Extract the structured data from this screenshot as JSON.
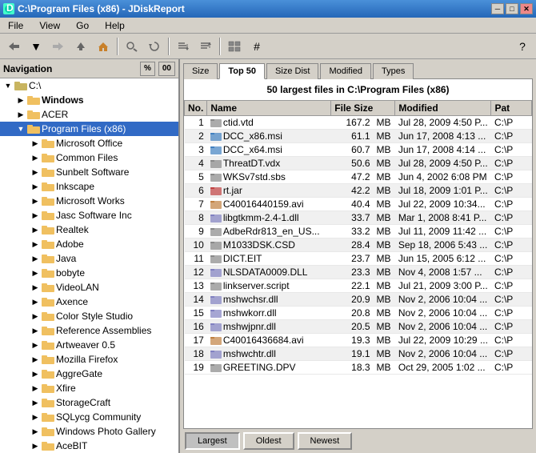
{
  "titleBar": {
    "title": "C:\\Program Files (x86) - JDiskReport",
    "icon": "disk-icon",
    "minimize": "─",
    "maximize": "□",
    "close": "✕"
  },
  "menu": {
    "items": [
      "File",
      "View",
      "Go",
      "Help"
    ]
  },
  "toolbar": {
    "buttons": [
      "◄",
      "▼",
      "◄",
      "►",
      "⌂",
      "🔍",
      "↺",
      "⇅",
      "⇵",
      "▦",
      "#"
    ],
    "help": "?"
  },
  "navigation": {
    "header": "Navigation",
    "percent": "%",
    "size": "00",
    "root": "C:\\",
    "tree": [
      {
        "label": "Windows",
        "level": 1,
        "expanded": true,
        "selected": false
      },
      {
        "label": "ACER",
        "level": 1,
        "expanded": false,
        "selected": false
      },
      {
        "label": "Program Files (x86)",
        "level": 1,
        "expanded": true,
        "selected": true
      },
      {
        "label": "Microsoft Office",
        "level": 2,
        "expanded": false,
        "selected": false
      },
      {
        "label": "Common Files",
        "level": 2,
        "expanded": false,
        "selected": false
      },
      {
        "label": "Sunbelt Software",
        "level": 2,
        "expanded": false,
        "selected": false
      },
      {
        "label": "Inkscape",
        "level": 2,
        "expanded": false,
        "selected": false
      },
      {
        "label": "Microsoft Works",
        "level": 2,
        "expanded": false,
        "selected": false
      },
      {
        "label": "Jasc Software Inc",
        "level": 2,
        "expanded": false,
        "selected": false
      },
      {
        "label": "Realtek",
        "level": 2,
        "expanded": false,
        "selected": false
      },
      {
        "label": "Adobe",
        "level": 2,
        "expanded": false,
        "selected": false
      },
      {
        "label": "Java",
        "level": 2,
        "expanded": false,
        "selected": false
      },
      {
        "label": "bobyte",
        "level": 2,
        "expanded": false,
        "selected": false
      },
      {
        "label": "VideoLAN",
        "level": 2,
        "expanded": false,
        "selected": false
      },
      {
        "label": "Axence",
        "level": 2,
        "expanded": false,
        "selected": false
      },
      {
        "label": "Color Style Studio",
        "level": 2,
        "expanded": false,
        "selected": false
      },
      {
        "label": "Reference Assemblies",
        "level": 2,
        "expanded": false,
        "selected": false
      },
      {
        "label": "Artweaver 0.5",
        "level": 2,
        "expanded": false,
        "selected": false
      },
      {
        "label": "Mozilla Firefox",
        "level": 2,
        "expanded": false,
        "selected": false
      },
      {
        "label": "AggreGate",
        "level": 2,
        "expanded": false,
        "selected": false
      },
      {
        "label": "Xfire",
        "level": 2,
        "expanded": false,
        "selected": false
      },
      {
        "label": "StorageCraft",
        "level": 2,
        "expanded": false,
        "selected": false
      },
      {
        "label": "SQLycg Community",
        "level": 2,
        "expanded": false,
        "selected": false
      },
      {
        "label": "Windows Photo Gallery",
        "level": 2,
        "expanded": false,
        "selected": false
      },
      {
        "label": "AceBIT",
        "level": 2,
        "expanded": false,
        "selected": false
      }
    ]
  },
  "tabs": [
    {
      "label": "Size",
      "active": false
    },
    {
      "label": "Top 50",
      "active": true
    },
    {
      "label": "Size Dist",
      "active": false
    },
    {
      "label": "Modified",
      "active": false
    },
    {
      "label": "Types",
      "active": false
    }
  ],
  "tableTitle": "50 largest files in C:\\Program Files (x86)",
  "tableHeaders": [
    "No.",
    "Name",
    "File Size",
    "Modified",
    "Pat"
  ],
  "tableRows": [
    {
      "no": 1,
      "name": "ctid.vtd",
      "size": "167.2",
      "unit": "MB",
      "modified": "Jul 28, 2009 4:50 P...",
      "path": "C:\\P"
    },
    {
      "no": 2,
      "name": "DCC_x86.msi",
      "size": "61.1",
      "unit": "MB",
      "modified": "Jun 17, 2008 4:13 ...",
      "path": "C:\\P"
    },
    {
      "no": 3,
      "name": "DCC_x64.msi",
      "size": "60.7",
      "unit": "MB",
      "modified": "Jun 17, 2008 4:14 ...",
      "path": "C:\\P"
    },
    {
      "no": 4,
      "name": "ThreatDT.vdx",
      "size": "50.6",
      "unit": "MB",
      "modified": "Jul 28, 2009 4:50 P...",
      "path": "C:\\P"
    },
    {
      "no": 5,
      "name": "WKSv7std.sbs",
      "size": "47.2",
      "unit": "MB",
      "modified": "Jun 4, 2002 6:08 PM",
      "path": "C:\\P"
    },
    {
      "no": 6,
      "name": "rt.jar",
      "size": "42.2",
      "unit": "MB",
      "modified": "Jul 18, 2009 1:01 P...",
      "path": "C:\\P"
    },
    {
      "no": 7,
      "name": "C40016440159.avi",
      "size": "40.4",
      "unit": "MB",
      "modified": "Jul 22, 2009 10:34...",
      "path": "C:\\P"
    },
    {
      "no": 8,
      "name": "libgtkmm-2.4-1.dll",
      "size": "33.7",
      "unit": "MB",
      "modified": "Mar 1, 2008 8:41 P...",
      "path": "C:\\P"
    },
    {
      "no": 9,
      "name": "AdbeRdr813_en_US...",
      "size": "33.2",
      "unit": "MB",
      "modified": "Jul 11, 2009 11:42 ...",
      "path": "C:\\P"
    },
    {
      "no": 10,
      "name": "M1033DSK.CSD",
      "size": "28.4",
      "unit": "MB",
      "modified": "Sep 18, 2006 5:43 ...",
      "path": "C:\\P"
    },
    {
      "no": 11,
      "name": "DICT.EIT",
      "size": "23.7",
      "unit": "MB",
      "modified": "Jun 15, 2005 6:12 ...",
      "path": "C:\\P"
    },
    {
      "no": 12,
      "name": "NLSDATA0009.DLL",
      "size": "23.3",
      "unit": "MB",
      "modified": "Nov 4, 2008 1:57 ...",
      "path": "C:\\P"
    },
    {
      "no": 13,
      "name": "linkserver.script",
      "size": "22.1",
      "unit": "MB",
      "modified": "Jul 21, 2009 3:00 P...",
      "path": "C:\\P"
    },
    {
      "no": 14,
      "name": "mshwchsr.dll",
      "size": "20.9",
      "unit": "MB",
      "modified": "Nov 2, 2006 10:04 ...",
      "path": "C:\\P"
    },
    {
      "no": 15,
      "name": "mshwkorr.dll",
      "size": "20.8",
      "unit": "MB",
      "modified": "Nov 2, 2006 10:04 ...",
      "path": "C:\\P"
    },
    {
      "no": 16,
      "name": "mshwjpnr.dll",
      "size": "20.5",
      "unit": "MB",
      "modified": "Nov 2, 2006 10:04 ...",
      "path": "C:\\P"
    },
    {
      "no": 17,
      "name": "C40016436684.avi",
      "size": "19.3",
      "unit": "MB",
      "modified": "Jul 22, 2009 10:29 ...",
      "path": "C:\\P"
    },
    {
      "no": 18,
      "name": "mshwchtr.dll",
      "size": "19.1",
      "unit": "MB",
      "modified": "Nov 2, 2006 10:04 ...",
      "path": "C:\\P"
    },
    {
      "no": 19,
      "name": "GREETING.DPV",
      "size": "18.3",
      "unit": "MB",
      "modified": "Oct 29, 2005 1:02 ...",
      "path": "C:\\P"
    }
  ],
  "bottomButtons": [
    {
      "label": "Largest",
      "active": true
    },
    {
      "label": "Oldest",
      "active": false
    },
    {
      "label": "Newest",
      "active": false
    }
  ]
}
